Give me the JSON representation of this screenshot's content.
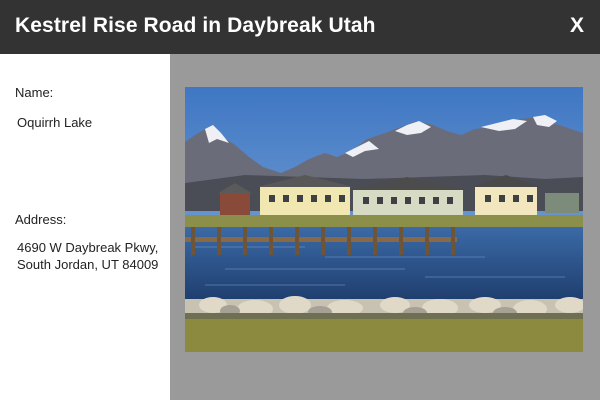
{
  "header": {
    "title": "Kestrel Rise Road in Daybreak Utah",
    "close_label": "X"
  },
  "details": {
    "name_label": "Name:",
    "name_value": "Oquirrh Lake",
    "address_label": "Address:",
    "address_line1": "4690 W Daybreak Pkwy,",
    "address_line2": "South Jordan, UT 84009"
  },
  "photo": {
    "subject": "lake-with-mountains-and-houses"
  },
  "colors": {
    "header_bg": "#333333",
    "photo_panel_bg": "#9a9a9a"
  }
}
